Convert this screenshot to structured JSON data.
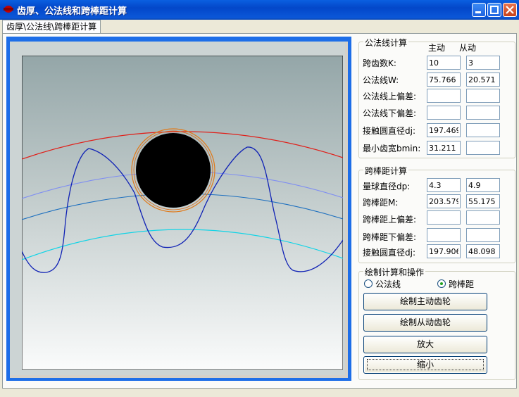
{
  "window": {
    "title": "齿厚、公法线和跨棒距计算"
  },
  "tabs": [
    {
      "label": "齿厚\\公法线\\跨棒距计算"
    }
  ],
  "common_normal": {
    "group_title": "公法线计算",
    "col_driving": "主动",
    "col_driven": "从动",
    "rows": [
      {
        "label": "跨齿数K:",
        "driving": "10",
        "driven": "3"
      },
      {
        "label": "公法线W:",
        "driving": "75.766",
        "driven": "20.571"
      },
      {
        "label": "公法线上偏差:",
        "driving": "",
        "driven": ""
      },
      {
        "label": "公法线下偏差:",
        "driving": "",
        "driven": ""
      },
      {
        "label": "接触圆直径dj:",
        "driving": "197.469",
        "driven": ""
      },
      {
        "label": "最小齿宽bmin:",
        "driving": "31.211",
        "driven": ""
      }
    ]
  },
  "over_pins": {
    "group_title": "跨棒距计算",
    "rows": [
      {
        "label": "量球直径dp:",
        "driving": "4.3",
        "driven": "4.9"
      },
      {
        "label": "跨棒距M:",
        "driving": "203.579",
        "driven": "55.175"
      },
      {
        "label": "跨棒距上偏差:",
        "driving": "",
        "driven": ""
      },
      {
        "label": "跨棒距下偏差:",
        "driving": "",
        "driven": ""
      },
      {
        "label": "接触圆直径dj:",
        "driving": "197.906",
        "driven": "48.098"
      }
    ]
  },
  "draw_ops": {
    "group_title": "绘制计算和操作",
    "radio_common_normal": "公法线",
    "radio_over_pins": "跨棒距",
    "selected": "跨棒距",
    "btn_draw_driving": "绘制主动齿轮",
    "btn_draw_driven": "绘制从动齿轮",
    "btn_zoom_in": "放大",
    "btn_zoom_out": "缩小"
  },
  "colors": {
    "accent": "#1d6ee8",
    "titlebar": "#0a5fe0"
  }
}
